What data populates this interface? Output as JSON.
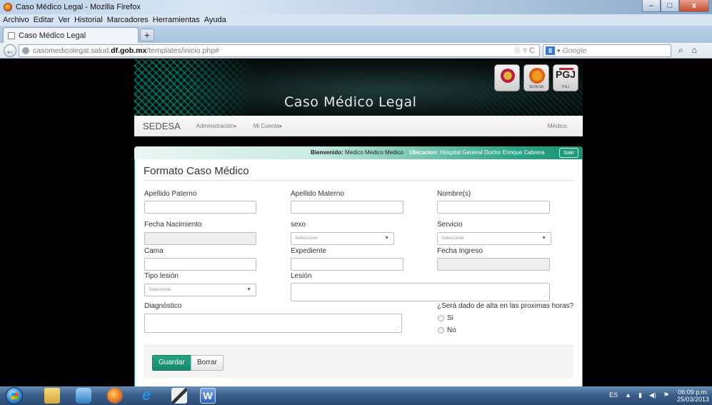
{
  "window": {
    "title": "Caso Médico Legal - Mozilla Firefox",
    "controls": {
      "minimize": "–",
      "maximize": "□",
      "close": "x"
    }
  },
  "menubar": {
    "items": [
      "Archivo",
      "Editar",
      "Ver",
      "Historial",
      "Marcadores",
      "Herramientas",
      "Ayuda"
    ]
  },
  "tab": {
    "label": "Caso Médico Legal",
    "new_tab": "+"
  },
  "navbar": {
    "url_prefix": "casomedicolegal.salud.",
    "url_host": "df.gob.mx",
    "url_path": "/templates/inicio.php#",
    "url_tools": "☆ ▿ C",
    "search_placeholder": "Google",
    "search_engine": "8"
  },
  "banner": {
    "title": "Caso Médico Legal",
    "logos": [
      "SEDESA",
      "PGJ",
      "PGJ"
    ]
  },
  "topnav": {
    "brand": "SEDESA",
    "items": [
      "Administración",
      "Mi Cuenta"
    ],
    "caret": "▾",
    "user": "Médico"
  },
  "infobar": {
    "welcome_label": "Bienvenido:",
    "welcome_value": "Medico Medico Medico",
    "location_label": "Ubicacion:",
    "location_value": "Hospital General Doctor Enrique Cabrera",
    "logout": "Salir"
  },
  "form": {
    "title": "Formato Caso Médico",
    "select_placeholder": "Seleccione",
    "labels": {
      "apellido_paterno": "Apellido Paterno",
      "apellido_materno": "Apellido Materno",
      "nombres": "Nombre(s)",
      "fecha_nacimiento": "Fecha Nacimiento",
      "sexo": "sexo",
      "servicio": "Servicio",
      "cama": "Cama",
      "expediente": "Expediente",
      "fecha_ingreso": "Fecha Ingreso",
      "tipo_lesion": "Tipo lesión",
      "lesion": "Lesión",
      "diagnostico": "Diagnóstico",
      "alta_question": "¿Será dado de alta en las proximas horas?"
    },
    "radio_options": [
      "Si",
      "No"
    ],
    "actions": {
      "save": "Guardar",
      "clear": "Borrar"
    }
  },
  "taskbar": {
    "word_label": "W",
    "ie_label": "e",
    "tray_lang": "ES",
    "tray_up": "▲",
    "clock_time": "06:09 p.m.",
    "clock_date": "25/03/2013"
  },
  "colors": {
    "accent": "#1f9a7a",
    "banner_bg": "#0b1414"
  }
}
